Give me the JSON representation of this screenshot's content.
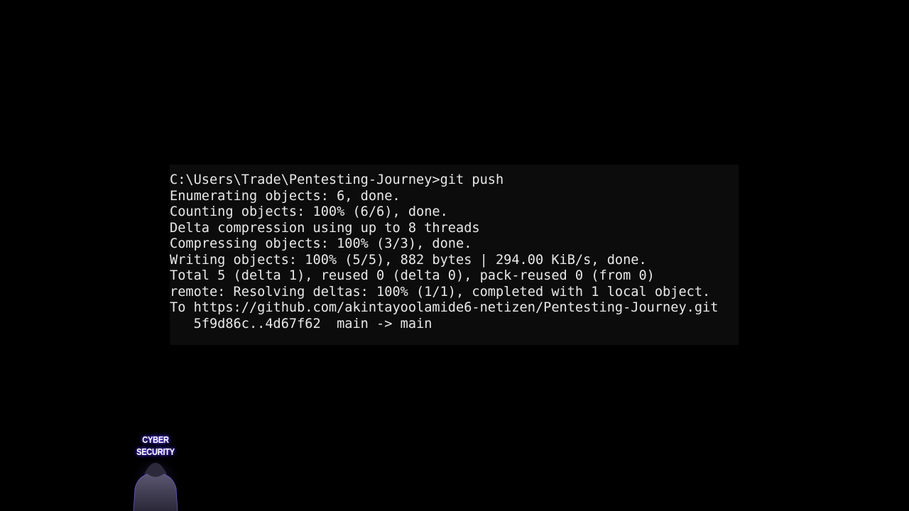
{
  "terminal": {
    "lines": [
      "C:\\Users\\Trade\\Pentesting-Journey>git push",
      "Enumerating objects: 6, done.",
      "Counting objects: 100% (6/6), done.",
      "Delta compression using up to 8 threads",
      "Compressing objects: 100% (3/3), done.",
      "Writing objects: 100% (5/5), 882 bytes | 294.00 KiB/s, done.",
      "Total 5 (delta 1), reused 0 (delta 0), pack-reused 0 (from 0)",
      "remote: Resolving deltas: 100% (1/1), completed with 1 local object.",
      "To https://github.com/akintayoolamide6-netizen/Pentesting-Journey.git",
      "   5f9d86c..4d67f62  main -> main"
    ],
    "text_color": "#e8e8e8",
    "background_color": "#0c0c0c"
  },
  "badge": {
    "title_line1": "CYBER",
    "title_line2": "SECURITY",
    "glow_color": "#5b3cff",
    "icon": "hooded-figure-icon"
  }
}
